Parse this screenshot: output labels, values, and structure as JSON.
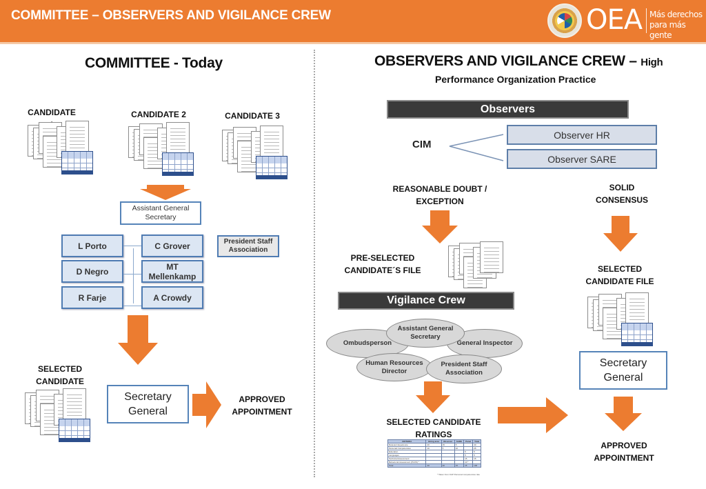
{
  "header": {
    "title": "COMMITTEE – OBSERVERS AND VIGILANCE CREW",
    "logo_text": "OEA",
    "slogan_line1": "Más derechos",
    "slogan_line2": "para más gente",
    "brand_color": "#ec7c30"
  },
  "left": {
    "title": "COMMITTEE - Today",
    "candidates": [
      "CANDIDATE 1",
      "CANDIDATE 2",
      "CANDIDATE 3"
    ],
    "assistant_box": "Assistant General Secretary",
    "members_left": [
      "L Porto",
      "D Negro",
      "R Farje"
    ],
    "members_right": [
      "C Grover",
      "MT Mellenkamp",
      "A Crowdy"
    ],
    "president_box": "President Staff Association",
    "selected_label": "SELECTED CANDIDATE",
    "secretary_box": "Secretary General",
    "approved_label": "APPROVED APPOINTMENT"
  },
  "right": {
    "title_main": "OBSERVERS AND VIGILANCE CREW –",
    "title_small": "High",
    "title_line2": "Performance Organization Practice",
    "observers_bar": "Observers",
    "cim_label": "CIM",
    "observer_boxes": [
      "Observer HR",
      "Observer SARE"
    ],
    "doubt_label": "REASONABLE DOUBT / EXCEPTION",
    "consensus_label": "SOLID CONSENSUS",
    "preselected_label": "PRE-SELECTED CANDIDATE´S FILE",
    "selected_file_label": "SELECTED CANDIDATE FILE",
    "vigilance_bar": "Vigilance Crew",
    "crew": {
      "assistant": "Assistant General Secretary",
      "ombudsperson": "Ombudsperson",
      "inspector": "General Inspector",
      "hr_director": "Human Resources Director",
      "president": "President Staff Association"
    },
    "ratings_label": "SELECTED CANDIDATE RATINGS",
    "ratings_table": {
      "headers": [
        "CRITERIA",
        "Hiring area",
        "Observer",
        "SARE",
        "Panel",
        "Total"
      ],
      "rows": [
        [
          "Relevant Experience",
          "20",
          "15",
          "5",
          "",
          "40"
        ],
        [
          "Personal Competencies",
          "10",
          "5",
          "10",
          "",
          "25"
        ],
        [
          "Education",
          "",
          "",
          "",
          "5",
          "5"
        ],
        [
          "Languages",
          "",
          "",
          "",
          "5",
          "5"
        ],
        [
          "Technical Assessment",
          "",
          "",
          "",
          "15",
          "15"
        ],
        [
          "Behavioral Assessment (PLDS) *",
          "",
          "",
          "",
          "10 *",
          ""
        ]
      ],
      "total_row": [
        "Total",
        "40",
        "20",
        "15",
        "15",
        "100"
      ],
      "note": "* Taken from OAP Personal competencies rate"
    },
    "secretary_box": "Secretary General",
    "approved_label": "APPROVED APPOINTMENT"
  }
}
